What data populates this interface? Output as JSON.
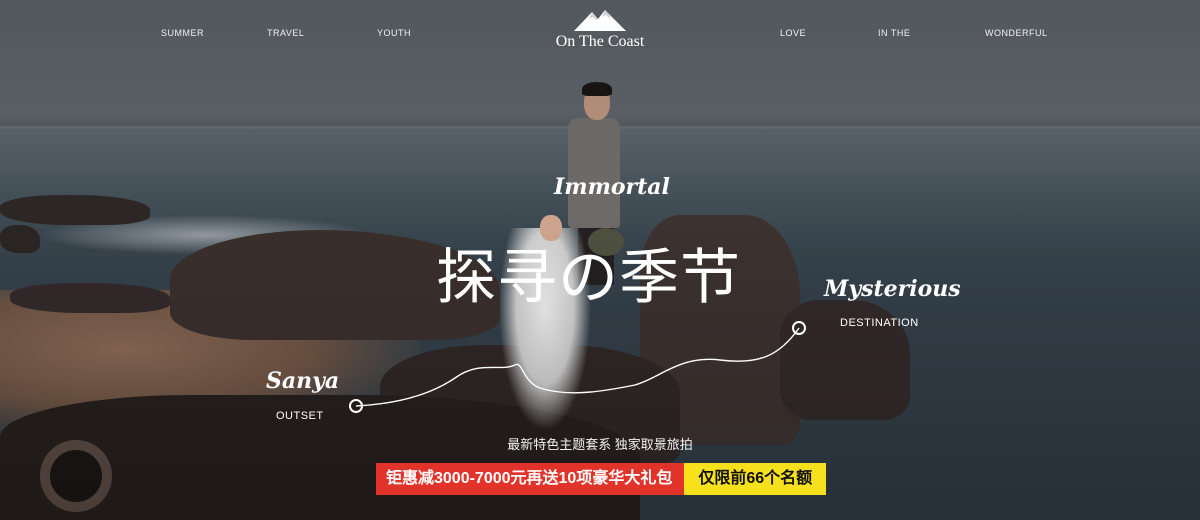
{
  "nav": {
    "left": [
      "SUMMER",
      "TRAVEL",
      "YOUTH"
    ],
    "right": [
      "LOVE",
      "IN THE",
      "WONDERFUL"
    ]
  },
  "logo": {
    "text": "On The Coast",
    "icon": "mountain-icon"
  },
  "hero": {
    "script_top": "Immortal",
    "headline": "探寻の季节",
    "start_script": "Sanya",
    "start_label": "OUTSET",
    "end_script": "Mysterious",
    "end_label": "DESTINATION",
    "tagline": "最新特色主题套系 独家取景旅拍",
    "promo_main": "钜惠减3000-7000元再送10项豪华大礼包",
    "promo_limit": "仅限前66个名额"
  },
  "colors": {
    "promo_red": "#e2332a",
    "promo_yellow": "#f7e01c"
  }
}
